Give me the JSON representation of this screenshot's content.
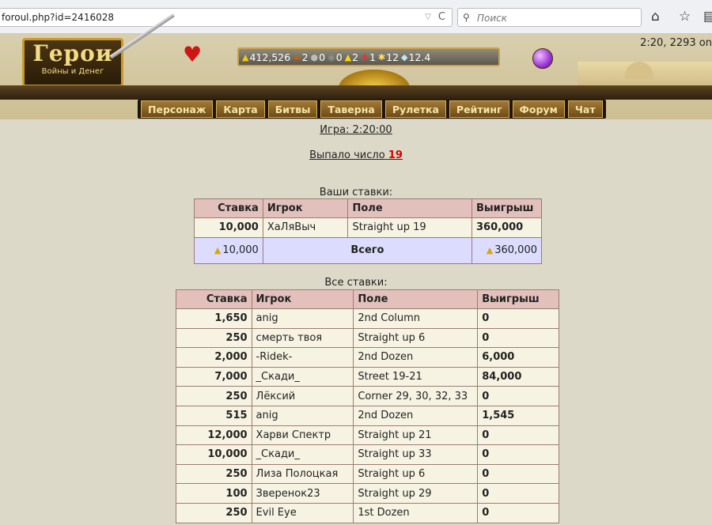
{
  "browser": {
    "url": "foroul.php?id=2416028",
    "search_placeholder": "Поиск"
  },
  "header": {
    "clock": "2:20, 2293 on",
    "logo_title": "Герои",
    "logo_subtitle": "Войны и Денег",
    "resources": {
      "gold": "412,526",
      "wood": "2",
      "ore": "0",
      "mercury": "0",
      "sulfur": "2",
      "crystals": "1",
      "gems": "12",
      "diamonds": "12.4"
    }
  },
  "nav": [
    "Персонаж",
    "Карта",
    "Битвы",
    "Таверна",
    "Рулетка",
    "Рейтинг",
    "Форум",
    "Чат"
  ],
  "game": {
    "label": "Игра: 2:20:00",
    "result_prefix": "Выпало число",
    "result_number": "19"
  },
  "my_bets": {
    "caption": "Ваши ставки:",
    "headers": [
      "Ставка",
      "Игрок",
      "Поле",
      "Выигрыш"
    ],
    "rows": [
      {
        "stake": "10,000",
        "player": "ХаЛяВыч",
        "field": "Straight up 19",
        "win": "360,000"
      }
    ],
    "total_label": "Всего",
    "total_stake": "10,000",
    "total_win": "360,000"
  },
  "all_bets": {
    "caption": "Все ставки:",
    "headers": [
      "Ставка",
      "Игрок",
      "Поле",
      "Выигрыш"
    ],
    "rows": [
      {
        "stake": "1,650",
        "player": "anig",
        "field": "2nd Column",
        "win": "0"
      },
      {
        "stake": "250",
        "player": "смерть твоя",
        "field": "Straight up 6",
        "win": "0"
      },
      {
        "stake": "2,000",
        "player": "-Ridek-",
        "field": "2nd Dozen",
        "win": "6,000"
      },
      {
        "stake": "7,000",
        "player": "_Скади_",
        "field": "Street 19-21",
        "win": "84,000"
      },
      {
        "stake": "250",
        "player": "Лёксий",
        "field": "Corner 29, 30, 32, 33",
        "win": "0"
      },
      {
        "stake": "515",
        "player": "anig",
        "field": "2nd Dozen",
        "win": "1,545"
      },
      {
        "stake": "12,000",
        "player": "Харви Спектр",
        "field": "Straight up 21",
        "win": "0"
      },
      {
        "stake": "10,000",
        "player": "_Скади_",
        "field": "Straight up 33",
        "win": "0"
      },
      {
        "stake": "250",
        "player": "Лиза Полоцкая",
        "field": "Straight up 6",
        "win": "0"
      },
      {
        "stake": "100",
        "player": "Зверенок23",
        "field": "Straight up 29",
        "win": "0"
      },
      {
        "stake": "250",
        "player": "Evil Eye",
        "field": "1st Dozen",
        "win": "0"
      }
    ]
  }
}
